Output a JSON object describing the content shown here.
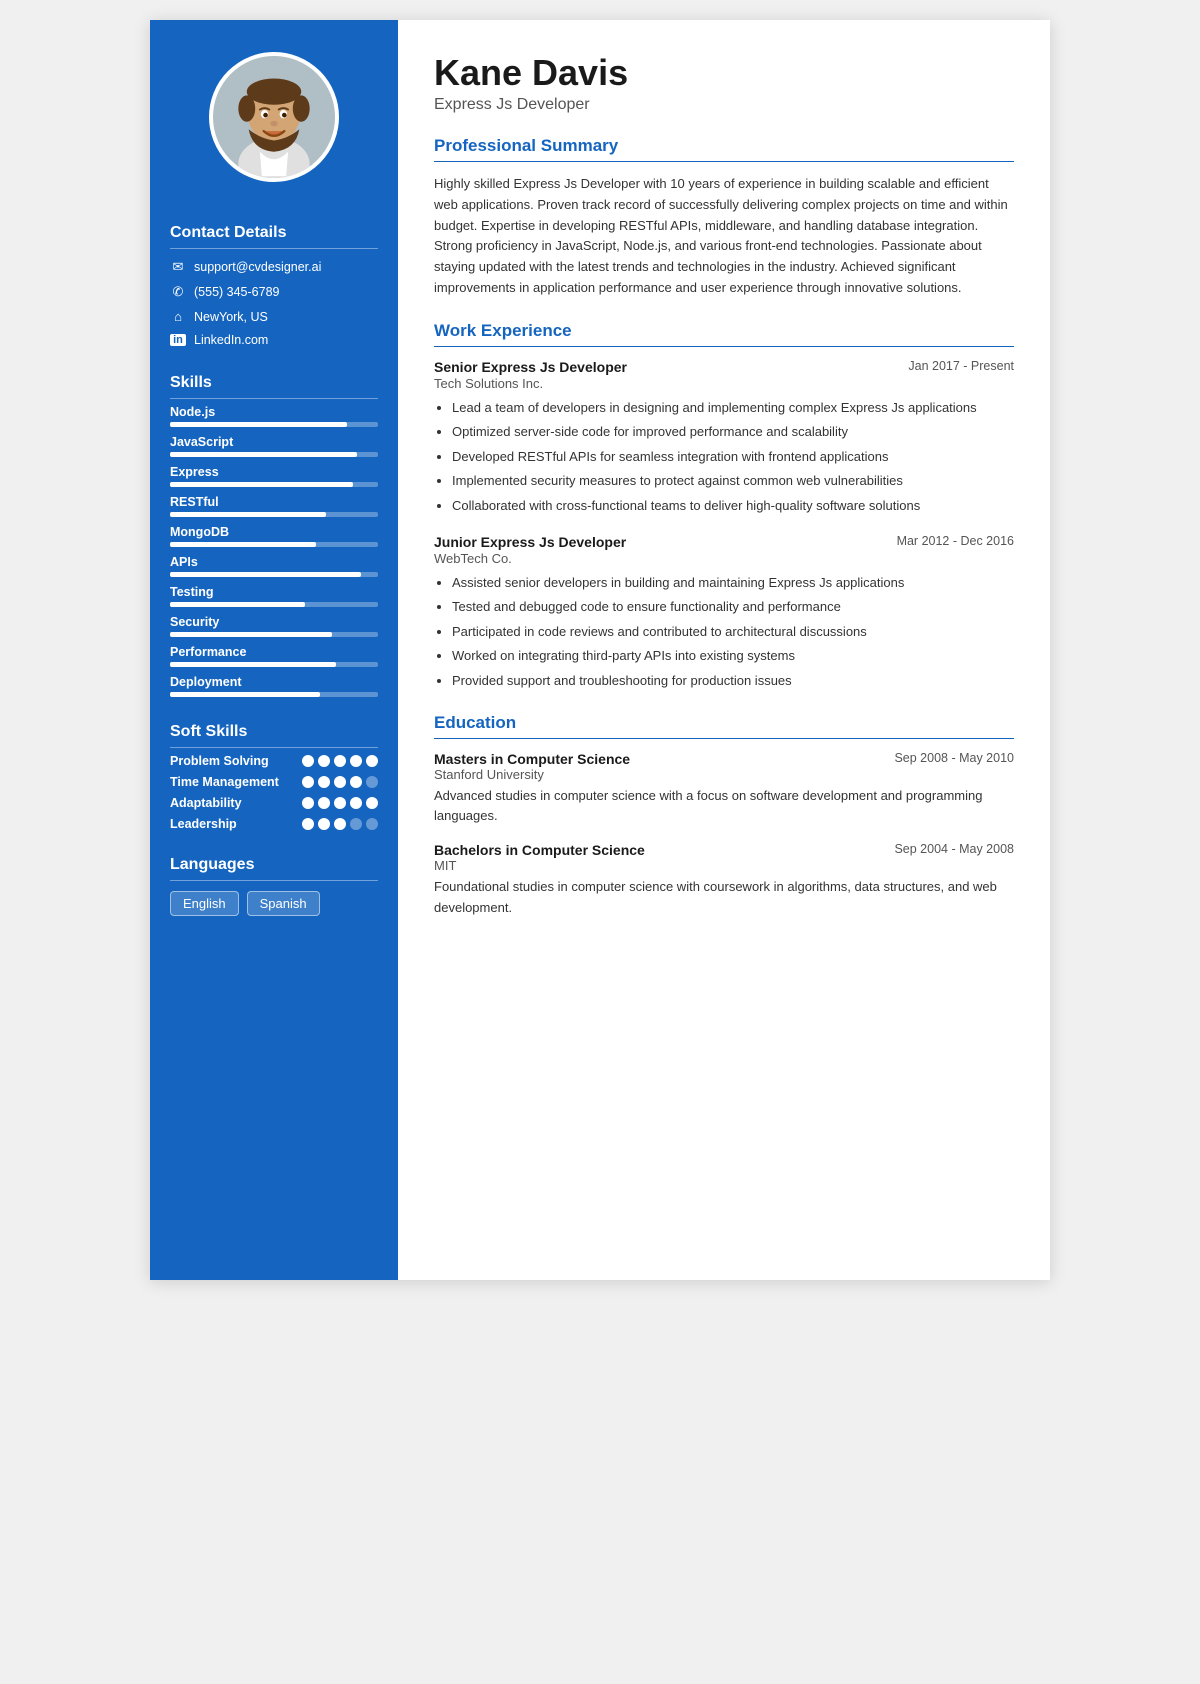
{
  "sidebar": {
    "contact_title": "Contact Details",
    "contact_items": [
      {
        "icon": "✉",
        "text": "support@cvdesigner.ai",
        "type": "email"
      },
      {
        "icon": "✆",
        "text": "(555) 345-6789",
        "type": "phone"
      },
      {
        "icon": "⌂",
        "text": "NewYork, US",
        "type": "location"
      },
      {
        "icon": "in",
        "text": "LinkedIn.com",
        "type": "linkedin"
      }
    ],
    "skills_title": "Skills",
    "skills": [
      {
        "name": "Node.js",
        "percent": 85
      },
      {
        "name": "JavaScript",
        "percent": 90
      },
      {
        "name": "Express",
        "percent": 88
      },
      {
        "name": "RESTful",
        "percent": 75
      },
      {
        "name": "MongoDB",
        "percent": 70
      },
      {
        "name": "APIs",
        "percent": 92
      },
      {
        "name": "Testing",
        "percent": 65
      },
      {
        "name": "Security",
        "percent": 78
      },
      {
        "name": "Performance",
        "percent": 80
      },
      {
        "name": "Deployment",
        "percent": 72
      }
    ],
    "soft_skills_title": "Soft Skills",
    "soft_skills": [
      {
        "name": "Problem Solving",
        "filled": 5,
        "total": 5
      },
      {
        "name": "Time Management",
        "filled": 4,
        "total": 5
      },
      {
        "name": "Adaptability",
        "filled": 5,
        "total": 5
      },
      {
        "name": "Leadership",
        "filled": 3,
        "total": 5
      }
    ],
    "languages_title": "Languages",
    "languages": [
      "English",
      "Spanish"
    ]
  },
  "main": {
    "name": "Kane Davis",
    "title": "Express Js Developer",
    "summary_title": "Professional Summary",
    "summary": "Highly skilled Express Js Developer with 10 years of experience in building scalable and efficient web applications. Proven track record of successfully delivering complex projects on time and within budget. Expertise in developing RESTful APIs, middleware, and handling database integration. Strong proficiency in JavaScript, Node.js, and various front-end technologies. Passionate about staying updated with the latest trends and technologies in the industry. Achieved significant improvements in application performance and user experience through innovative solutions.",
    "experience_title": "Work Experience",
    "jobs": [
      {
        "title": "Senior Express Js Developer",
        "date": "Jan 2017 - Present",
        "company": "Tech Solutions Inc.",
        "bullets": [
          "Lead a team of developers in designing and implementing complex Express Js applications",
          "Optimized server-side code for improved performance and scalability",
          "Developed RESTful APIs for seamless integration with frontend applications",
          "Implemented security measures to protect against common web vulnerabilities",
          "Collaborated with cross-functional teams to deliver high-quality software solutions"
        ]
      },
      {
        "title": "Junior Express Js Developer",
        "date": "Mar 2012 - Dec 2016",
        "company": "WebTech Co.",
        "bullets": [
          "Assisted senior developers in building and maintaining Express Js applications",
          "Tested and debugged code to ensure functionality and performance",
          "Participated in code reviews and contributed to architectural discussions",
          "Worked on integrating third-party APIs into existing systems",
          "Provided support and troubleshooting for production issues"
        ]
      }
    ],
    "education_title": "Education",
    "education": [
      {
        "degree": "Masters in Computer Science",
        "date": "Sep 2008 - May 2010",
        "school": "Stanford University",
        "desc": "Advanced studies in computer science with a focus on software development and programming languages."
      },
      {
        "degree": "Bachelors in Computer Science",
        "date": "Sep 2004 - May 2008",
        "school": "MIT",
        "desc": "Foundational studies in computer science with coursework in algorithms, data structures, and web development."
      }
    ]
  }
}
